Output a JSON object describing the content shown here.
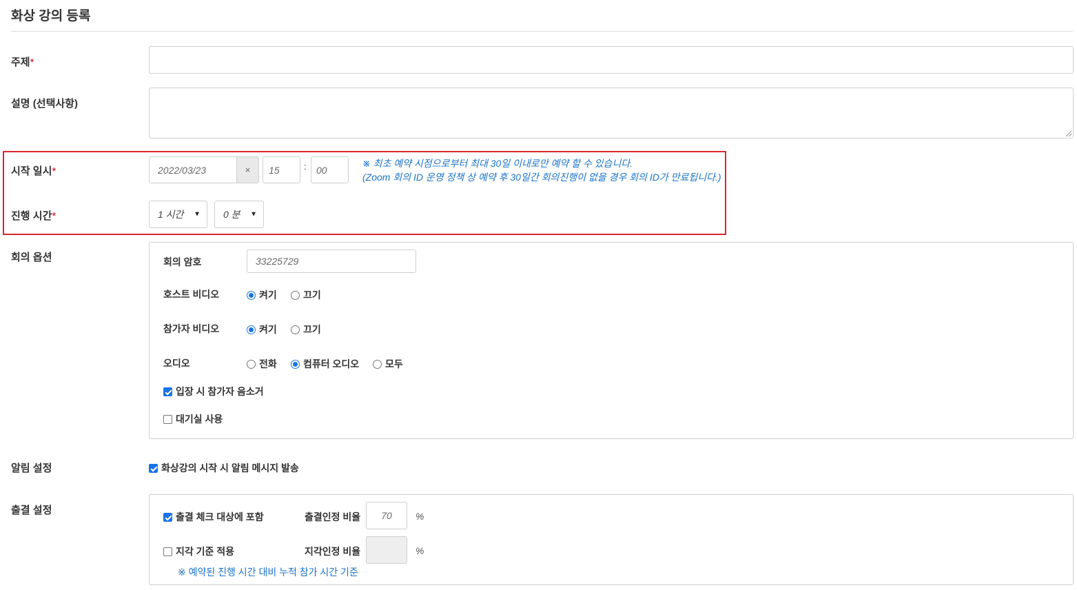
{
  "page": {
    "title": "화상 강의 등록"
  },
  "fields": {
    "subject": {
      "label": "주제",
      "required_mark": "*",
      "value": ""
    },
    "description": {
      "label": "설명 (선택사항)",
      "value": ""
    },
    "start": {
      "label": "시작 일시",
      "required_mark": "*",
      "date": "2022/03/23",
      "clear": "×",
      "hour": "15",
      "separator": ":",
      "minute": "00",
      "note_line1": "※ 최초 예약 시점으로부터 최대 30일 이내로만 예약 할 수 있습니다.",
      "note_line2": "(Zoom 회의 ID 운영 정책 상 예약 후 30일간 회의진행이 없을 경우 회의 ID가 만료됩니다.)"
    },
    "duration": {
      "label": "진행 시간",
      "required_mark": "*",
      "hours_selected": "1 시간",
      "minutes_selected": "0 분"
    }
  },
  "meeting_options": {
    "label": "회의 옵션",
    "password": {
      "label": "회의 암호",
      "value": "33225729"
    },
    "host_video": {
      "label": "호스트 비디오",
      "options": [
        "켜기",
        "끄기"
      ],
      "selected": "켜기"
    },
    "participant_video": {
      "label": "참가자 비디오",
      "options": [
        "켜기",
        "끄기"
      ],
      "selected": "켜기"
    },
    "audio": {
      "label": "오디오",
      "options": [
        "전화",
        "컴퓨터 오디오",
        "모두"
      ],
      "selected": "컴퓨터 오디오"
    },
    "mute_on_entry": {
      "label": "입장 시 참가자 음소거",
      "checked": true
    },
    "waiting_room": {
      "label": "대기실 사용",
      "checked": false
    }
  },
  "notification": {
    "label": "알림 설정",
    "send_message": {
      "label": "화상강의 시작 시 알림 메시지 발송",
      "checked": true
    }
  },
  "attendance": {
    "label": "출결 설정",
    "include_check": {
      "label": "출결 체크 대상에 포함",
      "checked": true
    },
    "attend_ratio": {
      "label": "출결인정 비율",
      "value": "70",
      "unit": "%"
    },
    "late_apply": {
      "label": "지각 기준 적용",
      "checked": false
    },
    "late_ratio": {
      "label": "지각인정 비율",
      "value": "",
      "unit": "%"
    },
    "note": "※ 예약된 진행 시간 대비 누적 참가 시간 기준"
  },
  "colors": {
    "accent": "#1a73e8",
    "highlight_border": "#d7262e",
    "note": "#1b73c9",
    "required": "#d0021b"
  }
}
